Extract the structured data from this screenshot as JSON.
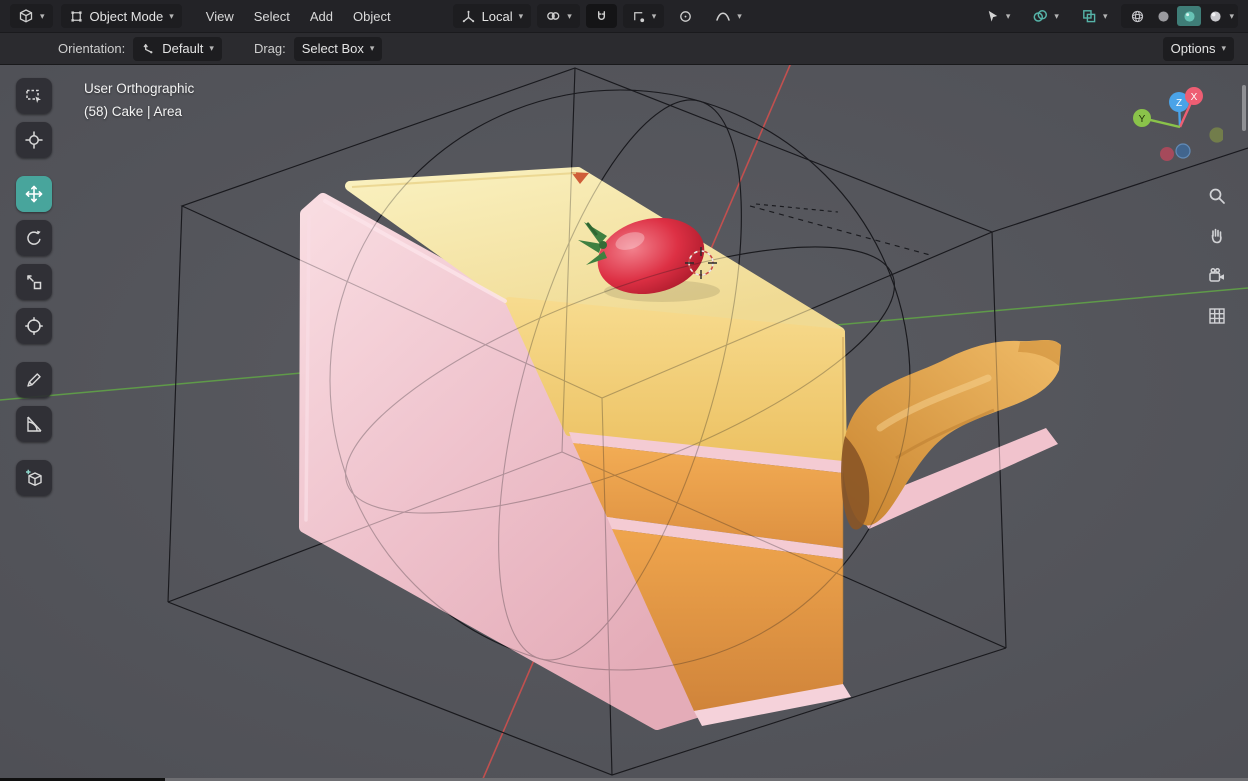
{
  "header": {
    "object_mode": "Object Mode",
    "menus": [
      "View",
      "Select",
      "Add",
      "Object"
    ],
    "transform_orientation": "Local"
  },
  "tool_settings": {
    "orientation_label": "Orientation:",
    "orientation_value": "Default",
    "drag_label": "Drag:",
    "drag_value": "Select Box",
    "options": "Options"
  },
  "viewport": {
    "info_line1": "User Orthographic",
    "info_line2": "(58) Cake | Area",
    "gizmo": {
      "x_label": "X",
      "y_label": "Y",
      "z_label": "Z"
    }
  },
  "toolbar": {
    "tools": [
      "select-box",
      "cursor",
      "move",
      "rotate",
      "scale",
      "transform",
      "annotate",
      "measure",
      "add-cube"
    ],
    "active_tool": "move"
  },
  "icons": {
    "chevron_down": "▾"
  },
  "colors": {
    "accent_teal": "#48a59c",
    "axis_x_red": "#c1504f",
    "axis_y_green": "#5f9a49",
    "gizmo_x": "#ee5e73",
    "gizmo_y": "#8ac34a",
    "gizmo_z": "#4aa3e8",
    "viewport_bg": "#54555b",
    "cake_frosting_pink": "#f3c9d1",
    "cake_top_cream": "#f8ecae",
    "cake_interior_yellow": "#f1cf7d",
    "cake_sponge_orange": "#e59a42",
    "caramel": "#e2a351",
    "strawberry_red": "#c21f2e",
    "leaf_green": "#3f8040"
  }
}
